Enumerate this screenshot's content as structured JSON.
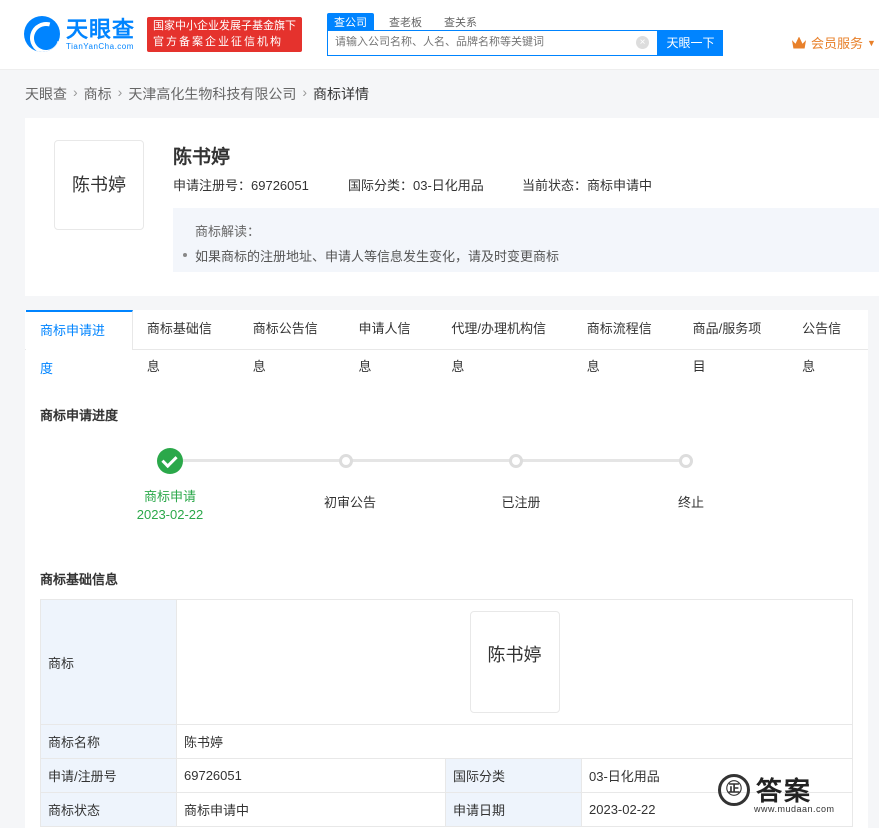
{
  "header": {
    "logo_cn": "天眼查",
    "logo_en": "TianYanCha.com",
    "badge_line1": "国家中小企业发展子基金旗下",
    "badge_line2": "官方备案企业征信机构",
    "search_tabs": [
      "查公司",
      "查老板",
      "查关系"
    ],
    "search_placeholder": "请输入公司名称、人名、品牌名称等关键词",
    "search_button": "天眼一下",
    "vip_label": "会员服务",
    "vip_caret": "▼"
  },
  "breadcrumb": [
    "天眼查",
    "商标",
    "天津高化生物科技有限公司",
    "商标详情"
  ],
  "trademark": {
    "name": "陈书婷",
    "reg_no_label": "申请注册号：",
    "reg_no": "69726051",
    "class_label": "国际分类：",
    "class_value": "03-日化用品",
    "status_label": "当前状态：",
    "status_value": "商标申请中",
    "note_title": "商标解读：",
    "note_text": "如果商标的注册地址、申请人等信息发生变化，请及时变更商标"
  },
  "tabs": [
    "商标申请进度",
    "商标基础信息",
    "商标公告信息",
    "申请人信息",
    "代理/办理机构信息",
    "商标流程信息",
    "商品/服务项目",
    "公告信息"
  ],
  "progress": {
    "title": "商标申请进度",
    "steps": [
      {
        "label": "商标申请",
        "date": "2023-02-22",
        "done": true
      },
      {
        "label": "初审公告"
      },
      {
        "label": "已注册"
      },
      {
        "label": "终止"
      }
    ]
  },
  "basic_info": {
    "title": "商标基础信息",
    "rows": {
      "trademark_label": "商标",
      "trademark_image_text": "陈书婷",
      "name_label": "商标名称",
      "name_value": "陈书婷",
      "reg_label": "申请/注册号",
      "reg_value": "69726051",
      "class_label": "国际分类",
      "class_value": "03-日化用品",
      "status_label": "商标状态",
      "status_value": "商标申请中",
      "date_label": "申请日期",
      "date_value": "2023-02-22"
    }
  },
  "watermark": {
    "logo": "㊣",
    "text": "答案",
    "url": "www.mudaan.com"
  },
  "colors": {
    "accent": "#0084ff",
    "success": "#2ba84a",
    "badge": "#e5322d",
    "vip": "#e8802a"
  }
}
